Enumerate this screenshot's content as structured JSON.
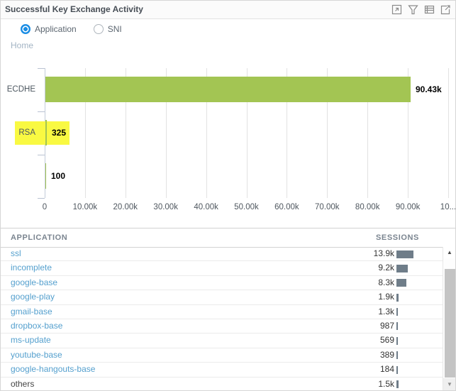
{
  "header": {
    "title": "Successful Key Exchange Activity",
    "icons": [
      "maximize",
      "filter",
      "table-view",
      "export"
    ]
  },
  "controls": {
    "radios": [
      {
        "label": "Application",
        "selected": true
      },
      {
        "label": "SNI",
        "selected": false
      }
    ]
  },
  "breadcrumb": {
    "home_label": "Home"
  },
  "chart_data": {
    "type": "bar",
    "orientation": "horizontal",
    "title": "",
    "categories": [
      "ECDHE",
      "RSA",
      ""
    ],
    "values": [
      90430,
      325,
      100
    ],
    "value_labels": [
      "90.43k",
      "325",
      "100"
    ],
    "xlim": [
      0,
      100000
    ],
    "x_ticks": [
      "0",
      "10.00k",
      "20.00k",
      "30.00k",
      "40.00k",
      "50.00k",
      "60.00k",
      "70.00k",
      "80.00k",
      "90.00k",
      "10..."
    ],
    "grid": true,
    "bar_color": "#a3c553",
    "highlight_color": "#f9f942",
    "highlighted_category": "RSA"
  },
  "table": {
    "columns": [
      "APPLICATION",
      "SESSIONS"
    ],
    "max_bar_value": 13900,
    "rows": [
      {
        "application": "ssl",
        "sessions": "13.9k",
        "value": 13900,
        "link": true
      },
      {
        "application": "incomplete",
        "sessions": "9.2k",
        "value": 9200,
        "link": true
      },
      {
        "application": "google-base",
        "sessions": "8.3k",
        "value": 8300,
        "link": true
      },
      {
        "application": "google-play",
        "sessions": "1.9k",
        "value": 1900,
        "link": true
      },
      {
        "application": "gmail-base",
        "sessions": "1.3k",
        "value": 1300,
        "link": true
      },
      {
        "application": "dropbox-base",
        "sessions": "987",
        "value": 987,
        "link": true
      },
      {
        "application": "ms-update",
        "sessions": "569",
        "value": 569,
        "link": true
      },
      {
        "application": "youtube-base",
        "sessions": "389",
        "value": 389,
        "link": true
      },
      {
        "application": "google-hangouts-base",
        "sessions": "184",
        "value": 184,
        "link": true
      },
      {
        "application": "others",
        "sessions": "1.5k",
        "value": 1500,
        "link": false
      }
    ]
  }
}
